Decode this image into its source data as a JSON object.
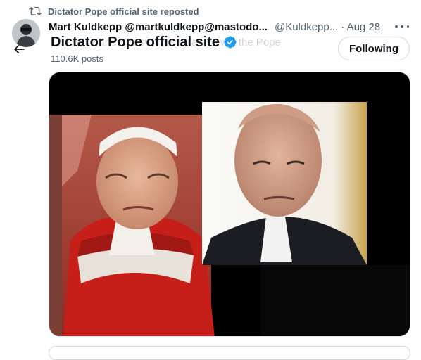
{
  "colors": {
    "accent": "#1d9bf0",
    "text_primary": "#0f1419",
    "text_secondary": "#536471",
    "border": "#cfd9de"
  },
  "repost": {
    "icon": "repost-icon",
    "label": "Dictator Pope official site reposted"
  },
  "tweet": {
    "author_name": "Mart Kuldkepp @martkuldkepp@mastodo...",
    "author_handle": "@Kuldkepp...",
    "date": "· Aug 28",
    "more_icon": "more-icon",
    "text_partial": "…till alive and has switched places with the Pope"
  },
  "profile_header": {
    "back_icon": "back-arrow-icon",
    "title": "Dictator Pope official site",
    "verified_icon": "verified-badge-icon",
    "posts_count": "110.6K posts",
    "follow_button": "Following"
  },
  "media": {
    "type": "photo collage"
  }
}
